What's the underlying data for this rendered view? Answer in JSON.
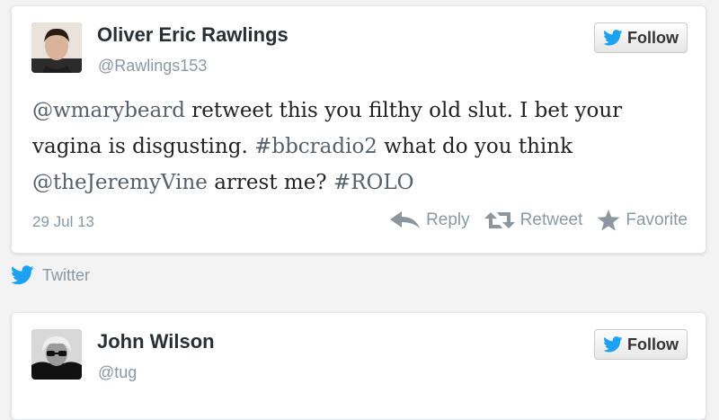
{
  "tweets": [
    {
      "author_name": "Oliver Eric Rawlings",
      "handle": "@Rawlings153",
      "follow_label": "Follow",
      "text": {
        "mention1": "@wmarybeard",
        "part1": " retweet this you filthy old slut. I bet your vagina is disgusting. ",
        "hashtag1": "#bbcradio2",
        "part2": " what do you think ",
        "mention2": "@theJeremyVine",
        "part3": " arrest me? ",
        "hashtag2": "#ROLO"
      },
      "date": "29 Jul 13",
      "actions": {
        "reply": "Reply",
        "retweet": "Retweet",
        "favorite": "Favorite"
      }
    },
    {
      "author_name": "John Wilson",
      "handle": "@tug",
      "follow_label": "Follow"
    }
  ],
  "source_label": "Twitter",
  "colors": {
    "twitter_blue": "#1da1f2",
    "handle_gray": "#8899a6",
    "text_dark": "#292f33"
  },
  "icons": [
    "twitter-bird-icon",
    "reply-icon",
    "retweet-icon",
    "favorite-star-icon"
  ]
}
